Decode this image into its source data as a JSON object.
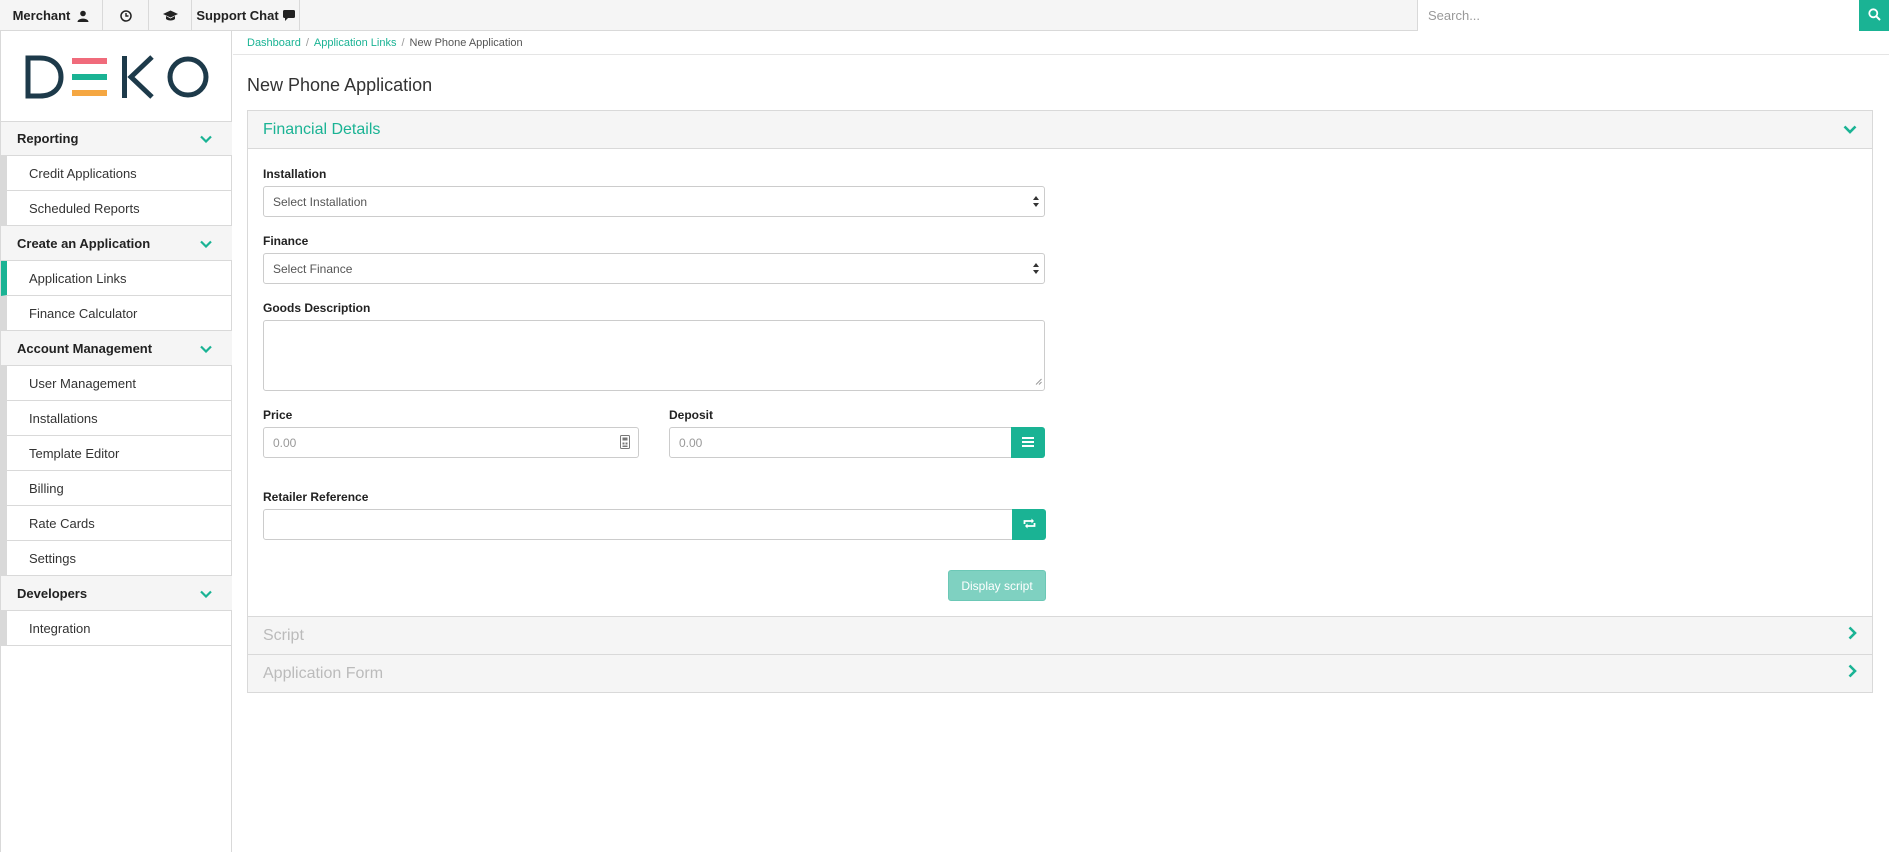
{
  "topbar": {
    "merchant_label": "Merchant",
    "support_chat_label": "Support Chat",
    "search_placeholder": "Search..."
  },
  "sidebar": {
    "logo_text": "DEKO",
    "groups": [
      {
        "label": "Reporting",
        "items": [
          "Credit Applications",
          "Scheduled Reports"
        ]
      },
      {
        "label": "Create an Application",
        "items": [
          "Application Links",
          "Finance Calculator"
        ]
      },
      {
        "label": "Account Management",
        "items": [
          "User Management",
          "Installations",
          "Template Editor",
          "Billing",
          "Rate Cards",
          "Settings"
        ]
      },
      {
        "label": "Developers",
        "items": [
          "Integration"
        ]
      }
    ],
    "active_item": "Application Links"
  },
  "breadcrumb": [
    "Dashboard",
    "Application Links",
    "New Phone Application"
  ],
  "page_title": "New Phone Application",
  "panels": {
    "financial_details": "Financial Details",
    "script": "Script",
    "application_form": "Application Form"
  },
  "form": {
    "installation_label": "Installation",
    "installation_value": "Select Installation",
    "finance_label": "Finance",
    "finance_value": "Select Finance",
    "goods_label": "Goods Description",
    "price_label": "Price",
    "price_placeholder": "0.00",
    "deposit_label": "Deposit",
    "deposit_placeholder": "0.00",
    "retailer_label": "Retailer Reference",
    "display_script": "Display script"
  },
  "colors": {
    "accent": "#1ab394",
    "logo_bars": [
      "#f06b7b",
      "#1ab394",
      "#f5a742"
    ]
  },
  "icons": [
    "user-icon",
    "clock-icon",
    "graduation-cap-icon",
    "comment-icon",
    "search-icon",
    "chevron-down-icon",
    "chevron-right-icon",
    "calculator-icon",
    "list-icon",
    "refresh-icon",
    "select-arrows-icon"
  ]
}
